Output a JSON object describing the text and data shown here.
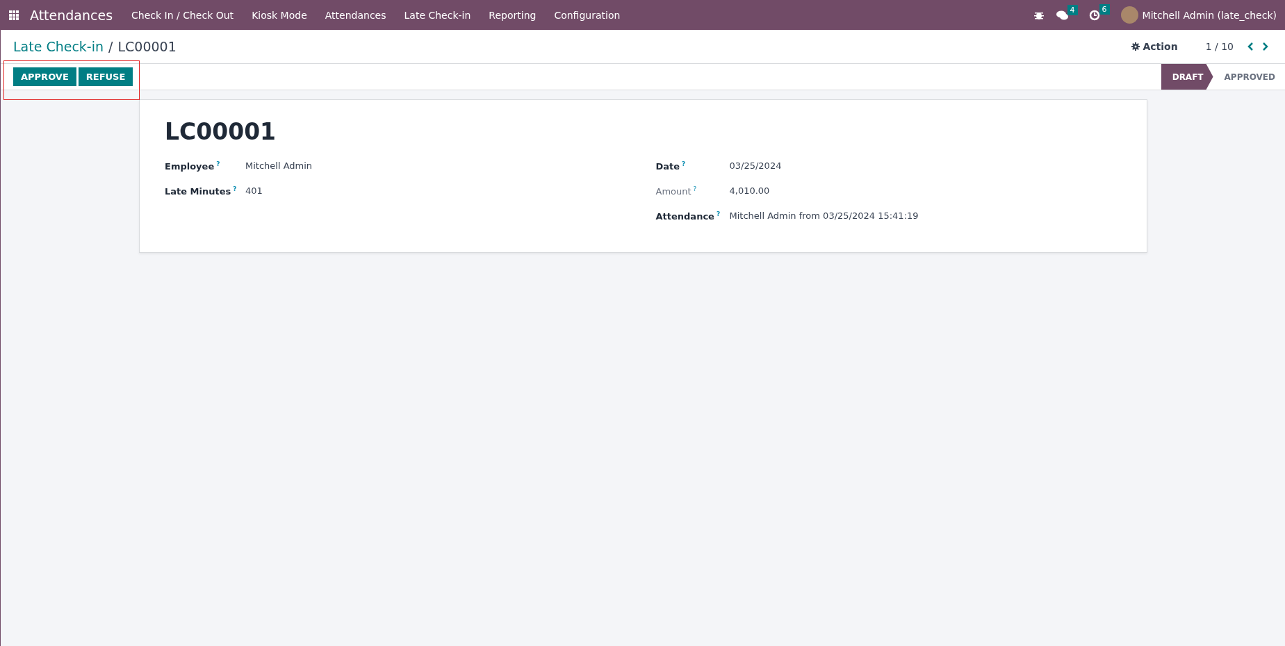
{
  "navbar": {
    "app_name": "Attendances",
    "menu": [
      "Check In / Check Out",
      "Kiosk Mode",
      "Attendances",
      "Late Check-in",
      "Reporting",
      "Configuration"
    ],
    "messages_count": "4",
    "activities_count": "6",
    "user": "Mitchell Admin (late_check)"
  },
  "breadcrumb": {
    "parent": "Late Check-in",
    "separator": "/",
    "current": "LC00001"
  },
  "control_panel": {
    "action": "Action",
    "pager": "1 / 10"
  },
  "action_buttons": {
    "highlighted": true,
    "items": [
      "APPROVE",
      "REFUSE"
    ]
  },
  "status_bar": [
    {
      "label": "DRAFT",
      "selected": true
    },
    {
      "label": "APPROVED",
      "selected": false
    }
  ],
  "form": {
    "title": "LC00001",
    "left_fields": [
      {
        "label": "Employee",
        "help": "?",
        "value": "Mitchell Admin",
        "muted": false
      },
      {
        "label": "Late Minutes",
        "help": "?",
        "value": "401",
        "muted": false
      }
    ],
    "right_fields": [
      {
        "label": "Date",
        "help": "?",
        "value": "03/25/2024",
        "muted": false
      },
      {
        "label": "Amount",
        "help": "?",
        "value": "4,010.00",
        "muted": true
      },
      {
        "label": "Attendance",
        "help": "?",
        "value": "Mitchell Admin from 03/25/2024 15:41:19",
        "muted": false
      }
    ]
  }
}
